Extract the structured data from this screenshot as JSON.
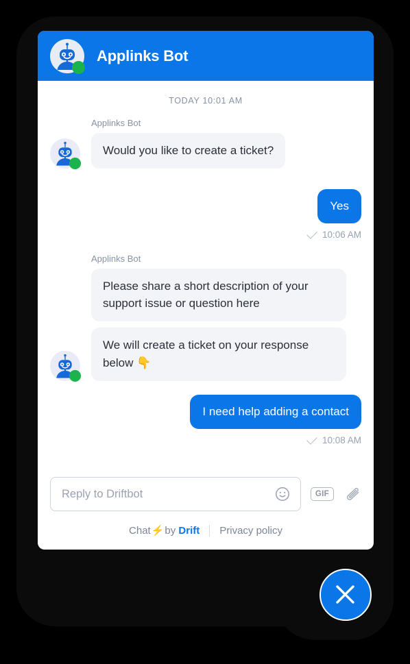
{
  "header": {
    "title": "Applinks Bot",
    "avatar_icon": "robot-avatar-icon",
    "status_icon": "online-status-dot",
    "background_color": "#0a76e8"
  },
  "conversation": {
    "daystamp": "TODAY 10:01 AM",
    "groups": [
      {
        "sender": "Applinks Bot",
        "side": "bot",
        "messages": [
          "Would you like to create a ticket?"
        ]
      },
      {
        "side": "user",
        "messages": [
          "Yes"
        ],
        "receipt_time": "10:06 AM",
        "receipt_icon": "delivered-check-icon"
      },
      {
        "sender": "Applinks Bot",
        "side": "bot",
        "messages": [
          "Please share a short description of your support issue or question here",
          "We will create a ticket on your response below 👇"
        ]
      },
      {
        "side": "user",
        "messages": [
          "I need help adding a contact"
        ],
        "receipt_time": "10:08 AM",
        "receipt_icon": "delivered-check-icon"
      }
    ]
  },
  "composer": {
    "placeholder": "Reply to Driftbot",
    "value": "",
    "emoji_icon": "smiley-face-icon",
    "gif_label": "GIF",
    "attach_icon": "paperclip-icon"
  },
  "footer": {
    "chat_text": "Chat",
    "bolt": "⚡",
    "by_text": "by",
    "brand": "Drift",
    "privacy": "Privacy policy"
  },
  "close_button": {
    "icon": "close-x-icon",
    "color": "#0a76e8"
  },
  "colors": {
    "accent": "#0a76e8",
    "bot_bubble": "#f3f4f7",
    "bot_text": "#2b2f38",
    "muted_text": "#8792a6",
    "online_green": "#1ab34c",
    "page_background": "#000000"
  }
}
